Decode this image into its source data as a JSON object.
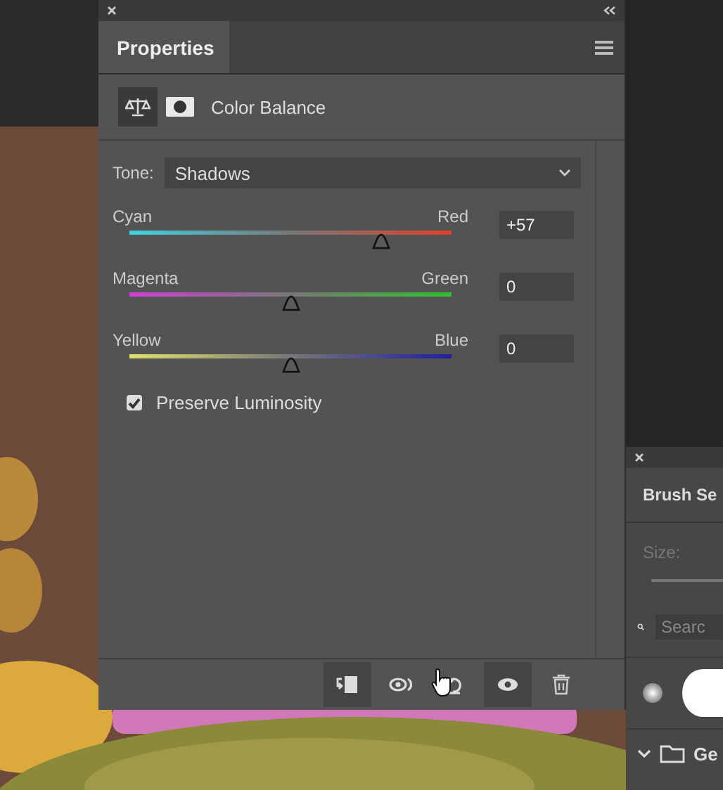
{
  "properties_panel": {
    "title": "Properties",
    "adjustment": "Color Balance",
    "tone": {
      "label": "Tone:",
      "value": "Shadows"
    },
    "sliders": [
      {
        "left": "Cyan",
        "right": "Red",
        "value": "+57",
        "level": 0.78
      },
      {
        "left": "Magenta",
        "right": "Green",
        "value": "0",
        "level": 0.5
      },
      {
        "left": "Yellow",
        "right": "Blue",
        "value": "0",
        "level": 0.5
      }
    ],
    "preserve_luminosity": {
      "label": "Preserve Luminosity",
      "checked": true
    },
    "toolbar": [
      {
        "kind": "clip",
        "selected": true
      },
      {
        "kind": "view",
        "selected": false
      },
      {
        "kind": "reset",
        "selected": false
      },
      {
        "kind": "eye",
        "selected": true
      },
      {
        "kind": "trash",
        "selected": false
      }
    ]
  },
  "brush_panel": {
    "title": "Brush Se",
    "size_label": "Size:",
    "search_placeholder": "Searc",
    "group": "Ge"
  }
}
